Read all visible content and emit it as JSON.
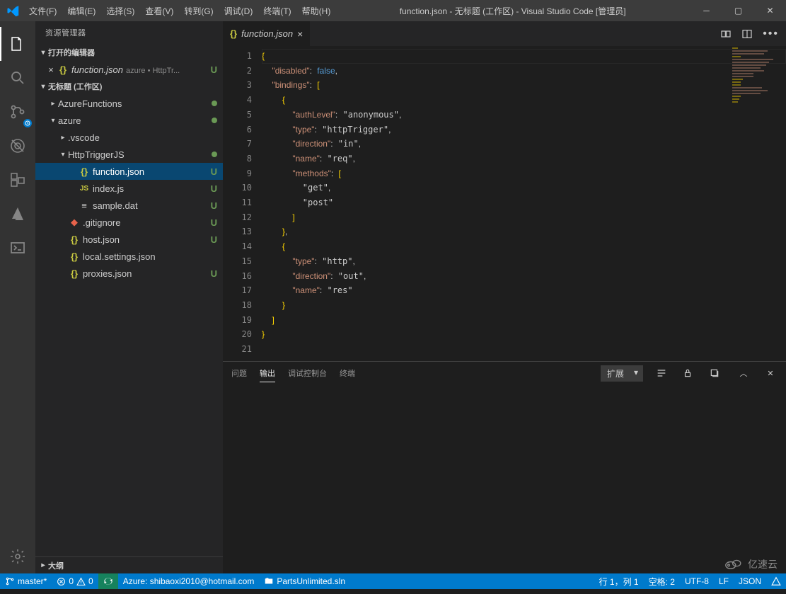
{
  "titlebar": {
    "menus": [
      "文件(F)",
      "编辑(E)",
      "选择(S)",
      "查看(V)",
      "转到(G)",
      "调试(D)",
      "终端(T)",
      "帮助(H)"
    ],
    "title": "function.json - 无标题 (工作区) - Visual Studio Code [管理员]"
  },
  "sidebar": {
    "title": "资源管理器",
    "sections": {
      "open_editors": "打开的编辑器",
      "workspace": "无标题 (工作区)",
      "outline": "大纲"
    },
    "open_editor": {
      "name": "function.json",
      "detail": "azure • HttpTr...",
      "badge": "U"
    },
    "tree": [
      {
        "indent": 1,
        "chev": "▸",
        "label": "AzureFunctions",
        "dot": true
      },
      {
        "indent": 1,
        "chev": "▾",
        "label": "azure",
        "dot": true
      },
      {
        "indent": 2,
        "chev": "▸",
        "label": ".vscode"
      },
      {
        "indent": 2,
        "chev": "▾",
        "label": "HttpTriggerJS",
        "dot": true
      },
      {
        "indent": 3,
        "icon": "json",
        "label": "function.json",
        "badge": "U",
        "selected": true
      },
      {
        "indent": 3,
        "icon": "js",
        "label": "index.js",
        "badge": "U"
      },
      {
        "indent": 3,
        "icon": "file",
        "label": "sample.dat",
        "badge": "U"
      },
      {
        "indent": 2,
        "icon": "git",
        "label": ".gitignore",
        "badge": "U"
      },
      {
        "indent": 2,
        "icon": "json",
        "label": "host.json",
        "badge": "U"
      },
      {
        "indent": 2,
        "icon": "json",
        "label": "local.settings.json"
      },
      {
        "indent": 2,
        "icon": "json",
        "label": "proxies.json",
        "badge": "U"
      }
    ]
  },
  "tab": {
    "name": "function.json"
  },
  "code_lines": [
    "{",
    "  \"disabled\": false,",
    "  \"bindings\": [",
    "    {",
    "      \"authLevel\": \"anonymous\",",
    "      \"type\": \"httpTrigger\",",
    "      \"direction\": \"in\",",
    "      \"name\": \"req\",",
    "      \"methods\": [",
    "        \"get\",",
    "        \"post\"",
    "      ]",
    "    },",
    "    {",
    "      \"type\": \"http\",",
    "      \"direction\": \"out\",",
    "      \"name\": \"res\"",
    "    }",
    "  ]",
    "}",
    ""
  ],
  "panel": {
    "tabs": [
      "问题",
      "输出",
      "调试控制台",
      "终端"
    ],
    "active": 1,
    "dropdown": "扩展"
  },
  "status": {
    "branch": "master*",
    "errors": "0",
    "warnings": "0",
    "azure": "Azure: shibaoxi2010@hotmail.com",
    "solution": "PartsUnlimited.sln",
    "position": "行 1，列 1",
    "spaces": "空格: 2",
    "encoding": "UTF-8",
    "eol": "LF",
    "lang": "JSON"
  },
  "watermark": "亿速云"
}
